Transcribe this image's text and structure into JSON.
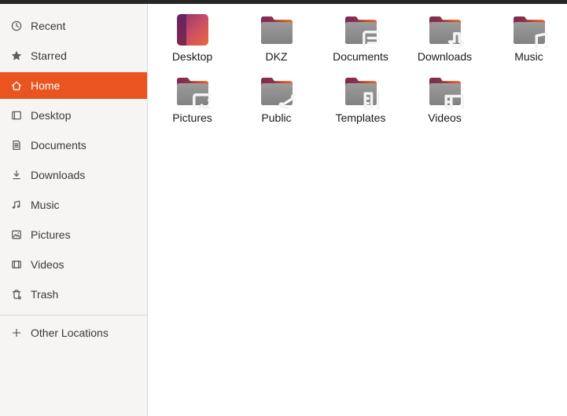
{
  "colors": {
    "accent": "#E95420",
    "topbar": "#262626",
    "sidebar_bg": "#f6f5f4",
    "sidebar_border": "#d9d8d7",
    "folder_body_gray": "#8b8b8b",
    "folder_tab_maroon": "#7e2a55",
    "folder_tab_orange": "#ee5f29",
    "desktop_icon_purple": "#5e2257",
    "desktop_icon_orange": "#ea6a3e"
  },
  "sidebar": {
    "items": [
      {
        "label": "Recent",
        "icon": "recent-clock-icon",
        "selected": false
      },
      {
        "label": "Starred",
        "icon": "star-icon",
        "selected": false
      },
      {
        "label": "Home",
        "icon": "home-icon",
        "selected": true
      },
      {
        "label": "Desktop",
        "icon": "desktop-icon",
        "selected": false
      },
      {
        "label": "Documents",
        "icon": "document-icon",
        "selected": false
      },
      {
        "label": "Downloads",
        "icon": "download-icon",
        "selected": false
      },
      {
        "label": "Music",
        "icon": "music-icon",
        "selected": false
      },
      {
        "label": "Pictures",
        "icon": "picture-icon",
        "selected": false
      },
      {
        "label": "Videos",
        "icon": "video-icon",
        "selected": false
      },
      {
        "label": "Trash",
        "icon": "trash-icon",
        "selected": false
      }
    ],
    "other_locations": {
      "label": "Other Locations",
      "icon": "plus-icon"
    }
  },
  "files": {
    "items": [
      {
        "name": "Desktop",
        "icon": "desktop-gradient-icon",
        "emblem": ""
      },
      {
        "name": "DKZ",
        "icon": "folder-icon",
        "emblem": ""
      },
      {
        "name": "Documents",
        "icon": "folder-icon",
        "emblem": "document-icon"
      },
      {
        "name": "Downloads",
        "icon": "folder-icon",
        "emblem": "download-icon"
      },
      {
        "name": "Music",
        "icon": "folder-icon",
        "emblem": "music-icon"
      },
      {
        "name": "Pictures",
        "icon": "folder-icon",
        "emblem": "picture-icon"
      },
      {
        "name": "Public",
        "icon": "folder-icon",
        "emblem": "share-icon"
      },
      {
        "name": "Templates",
        "icon": "folder-icon",
        "emblem": "template-icon"
      },
      {
        "name": "Videos",
        "icon": "folder-icon",
        "emblem": "video-icon"
      }
    ]
  }
}
